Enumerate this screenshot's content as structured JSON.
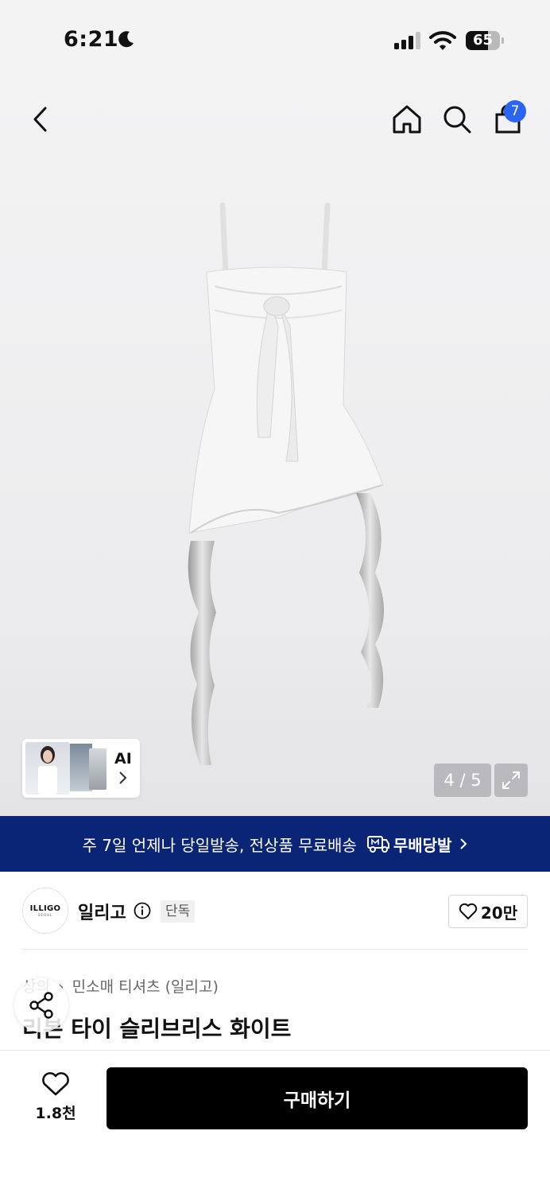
{
  "status_bar": {
    "time": "6:21",
    "battery": "65",
    "battery_level": 0.65
  },
  "header": {
    "cart_count": "7"
  },
  "gallery": {
    "ai_label": "AI",
    "page_counter": "4 / 5",
    "current_page": 4,
    "total_pages": 5
  },
  "promo": {
    "text": "주 7일 언제나 당일발송, 전상품 무료배송",
    "brand_label": "무배당발"
  },
  "brand": {
    "logo_text": "ILLIGO",
    "logo_sub": "SEOUL",
    "name": "일리고",
    "tag": "단독",
    "likes": "20만"
  },
  "product": {
    "breadcrumb": [
      "상의",
      "민소매 티셔츠 (일리고)"
    ],
    "title": "리본 타이 슬리브리스 화이트"
  },
  "bottom": {
    "wish_count": "1.8천",
    "buy_label": "구매하기"
  },
  "colors": {
    "promo_bg": "#0b2576",
    "badge": "#2c64f2",
    "buy_bg": "#000000"
  }
}
